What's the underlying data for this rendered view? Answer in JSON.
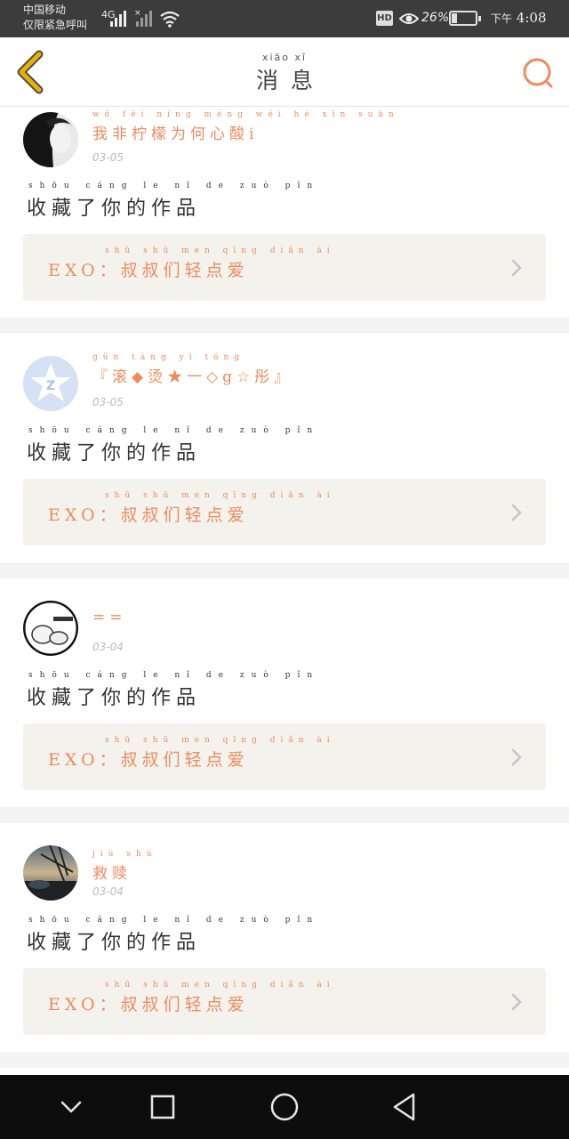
{
  "status_bar": {
    "carrier_line1": "中国移动",
    "carrier_line2": "仅限紧急呼叫",
    "network": "4G",
    "hd": "HD",
    "battery": "26%",
    "battery_level": 0.26,
    "time_prefix": "下午",
    "time": "4:08"
  },
  "header": {
    "title": "消息",
    "title_pinyin": "xiāo   xī"
  },
  "messages": [
    {
      "username": "我非柠檬为何心酸i",
      "username_pinyin": "wǒ fēi níng méng wéi hé xīn suān",
      "date": "03-05",
      "action": "收藏了你的作品",
      "action_pinyin": "shōu cáng  le   nǐ   de  zuò pǐn",
      "work_title": "EXO：叔叔们轻点爱",
      "work_pinyin": "shū shū men qīng diǎn ài"
    },
    {
      "username": "『滚◆烫★一◇g☆彤』",
      "username_pinyin": "gǔn   tàng     yī            tóng",
      "date": "03-05",
      "action": "收藏了你的作品",
      "action_pinyin": "shōu cáng  le   nǐ   de  zuò pǐn",
      "work_title": "EXO：叔叔们轻点爱",
      "work_pinyin": "shū shū men qīng diǎn ài"
    },
    {
      "username": "==",
      "username_pinyin": "",
      "date": "03-04",
      "action": "收藏了你的作品",
      "action_pinyin": "shōu cáng  le   nǐ   de  zuò pǐn",
      "work_title": "EXO：叔叔们轻点爱",
      "work_pinyin": "shū shū men qīng diǎn ài"
    },
    {
      "username": "救赎",
      "username_pinyin": "jiù shú",
      "date": "03-04",
      "action": "收藏了你的作品",
      "action_pinyin": "shōu cáng  le   nǐ   de  zuò pǐn",
      "work_title": "EXO：叔叔们轻点爱",
      "work_pinyin": "shū shū men qīng diǎn ài"
    }
  ],
  "icons": {
    "back": "chevron-left-icon",
    "search": "search-icon",
    "nav_down": "chevron-down-icon",
    "nav_recent": "square-icon",
    "nav_home": "circle-icon",
    "nav_back": "triangle-back-icon"
  },
  "colors": {
    "accent": "#f08a5d",
    "back_icon": "#e8b100",
    "card_link_bg": "#f3f2ec"
  }
}
